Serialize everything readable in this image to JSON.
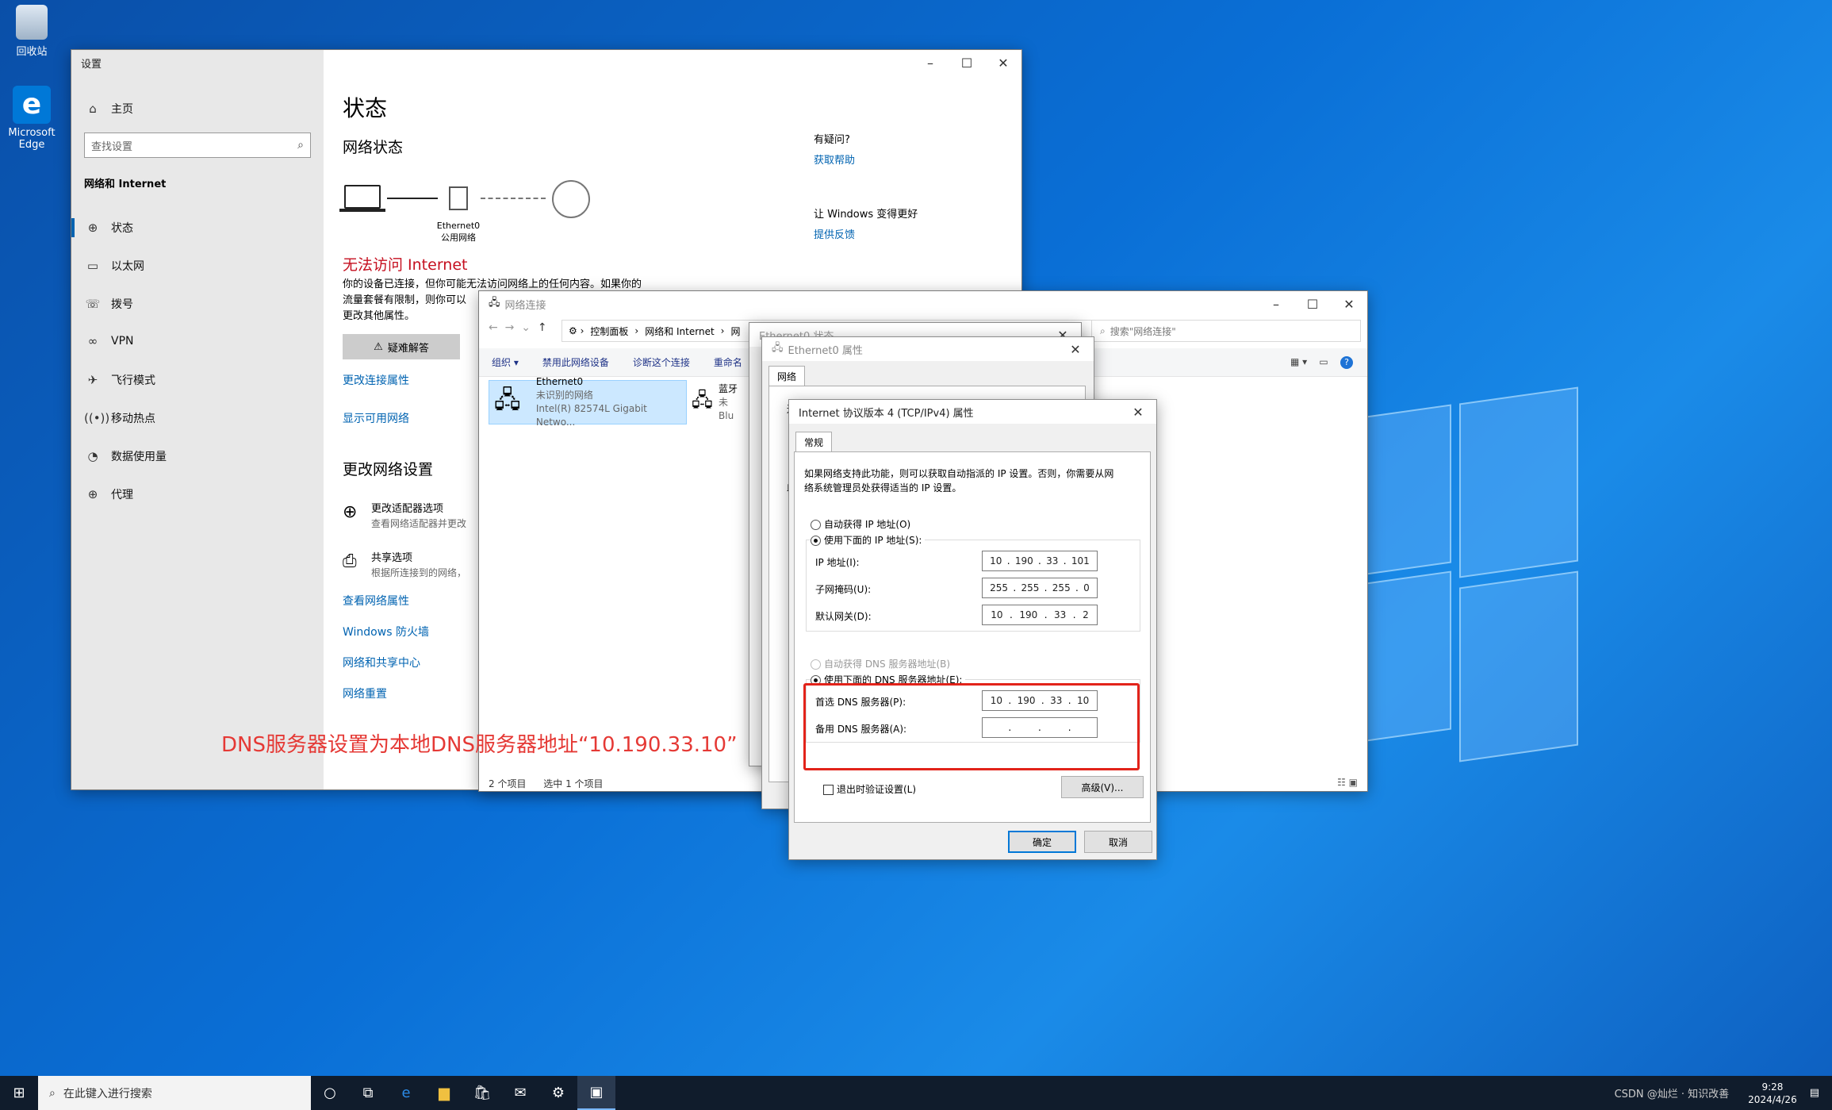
{
  "desktop": {
    "recycle_bin": "回收站",
    "edge_line1": "Microsoft",
    "edge_line2": "Edge"
  },
  "settings": {
    "window_title": "设置",
    "home": "主页",
    "search_placeholder": "查找设置",
    "section": "网络和 Internet",
    "nav": [
      "状态",
      "以太网",
      "拨号",
      "VPN",
      "飞行模式",
      "移动热点",
      "数据使用量",
      "代理"
    ],
    "page_title": "状态",
    "network_status": "网络状态",
    "adapter_name": "Ethernet0",
    "adapter_network": "公用网络",
    "no_internet": "无法访问 Internet",
    "desc_line1": "你的设备已连接，但你可能无法访问网络上的任何内容。如果你的",
    "desc_line2": "流量套餐有限制，则你可以",
    "desc_line3": "更改其他属性。",
    "troubleshoot": "疑难解答",
    "change_conn_props": "更改连接属性",
    "show_networks": "显示可用网络",
    "change_settings": "更改网络设置",
    "adapter_opts": "更改适配器选项",
    "adapter_opts_desc": "查看网络适配器并更改",
    "sharing_opts": "共享选项",
    "sharing_opts_desc": "根据所连接到的网络，",
    "view_props": "查看网络属性",
    "firewall": "Windows 防火墙",
    "sharing_center": "网络和共享中心",
    "reset": "网络重置",
    "question": "有疑问?",
    "get_help": "获取帮助",
    "improve": "让 Windows 变得更好",
    "feedback": "提供反馈"
  },
  "netconn": {
    "window_title": "网络连接",
    "breadcrumb": [
      "控制面板",
      "网络和 Internet",
      "网"
    ],
    "search_placeholder": "搜索\"网络连接\"",
    "commands": [
      "组织 ▾",
      "禁用此网络设备",
      "诊断这个连接",
      "重命名"
    ],
    "adapter1_name": "Ethernet0",
    "adapter1_status": "未识别的网络",
    "adapter1_device": "Intel(R) 82574L Gigabit Netwo...",
    "adapter2_name": "蓝牙",
    "adapter2_status": "未",
    "adapter2_device": "Blu",
    "status_count": "2 个项目",
    "status_selected": "选中 1 个项目"
  },
  "eth_status": {
    "title": "Ethernet0 状态"
  },
  "eth_props": {
    "title": "Ethernet0 属性",
    "tab": "网络",
    "side_text1": "连",
    "side_text2": "此"
  },
  "ipv4": {
    "title": "Internet 协议版本 4 (TCP/IPv4) 属性",
    "tab": "常规",
    "intro_line1": "如果网络支持此功能，则可以获取自动指派的 IP 设置。否则，你需要从网",
    "intro_line2": "络系统管理员处获得适当的 IP 设置。",
    "auto_ip": "自动获得 IP 地址(O)",
    "manual_ip": "使用下面的 IP 地址(S):",
    "ip_label": "IP 地址(I):",
    "ip": [
      "10",
      "190",
      "33",
      "101"
    ],
    "mask_label": "子网掩码(U):",
    "mask": [
      "255",
      "255",
      "255",
      "0"
    ],
    "gw_label": "默认网关(D):",
    "gw": [
      "10",
      "190",
      "33",
      "2"
    ],
    "auto_dns": "自动获得 DNS 服务器地址(B)",
    "manual_dns": "使用下面的 DNS 服务器地址(E):",
    "dns1_label": "首选 DNS 服务器(P):",
    "dns1": [
      "10",
      "190",
      "33",
      "10"
    ],
    "dns2_label": "备用 DNS 服务器(A):",
    "validate": "退出时验证设置(L)",
    "advanced": "高级(V)...",
    "ok": "确定",
    "cancel": "取消"
  },
  "annotation": "DNS服务器设置为本地DNS服务器地址“10.190.33.10”",
  "taskbar": {
    "search_placeholder": "在此键入进行搜索",
    "time": "9:28",
    "date": "2024/4/26",
    "watermark": "CSDN @灿烂 · 知识改善"
  }
}
